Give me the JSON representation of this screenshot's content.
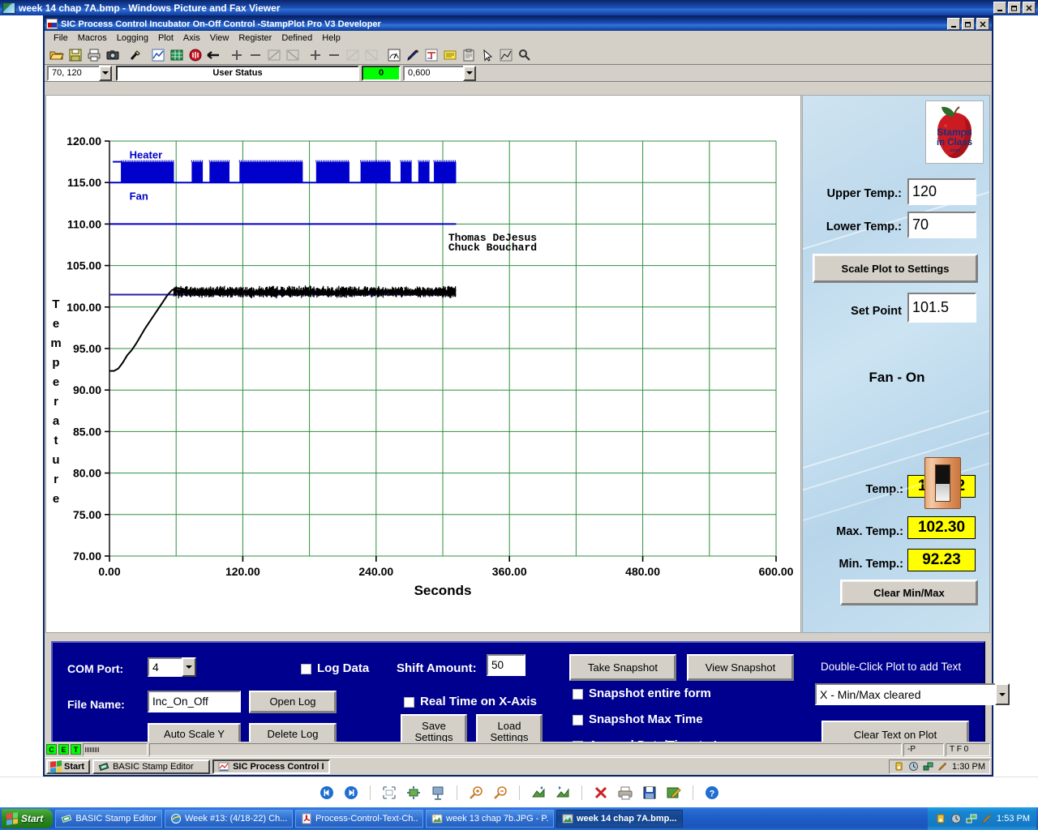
{
  "viewer": {
    "title": "week 14 chap 7A.bmp - Windows Picture and Fax Viewer",
    "icon": "image-file-icon",
    "controls": {
      "minimize": "minimize-icon",
      "restore": "restore-icon",
      "close": "close-icon"
    },
    "toolbar": [
      {
        "name": "previous-image-button",
        "glyph": "⏮"
      },
      {
        "name": "next-image-button",
        "glyph": "⏭"
      },
      {
        "name": "best-fit-button",
        "glyph": "⬚"
      },
      {
        "name": "actual-size-button",
        "glyph": "✥"
      },
      {
        "name": "start-slideshow-button",
        "glyph": "⏵"
      },
      {
        "name": "zoom-in-button",
        "glyph": "+"
      },
      {
        "name": "zoom-out-button",
        "glyph": "−"
      },
      {
        "name": "rotate-clockwise-button",
        "glyph": "↻"
      },
      {
        "name": "rotate-counterclockwise-button",
        "glyph": "↺"
      },
      {
        "name": "delete-button",
        "glyph": "✕"
      },
      {
        "name": "print-button",
        "glyph": "⎙"
      },
      {
        "name": "copy-to-button",
        "glyph": "💾"
      },
      {
        "name": "edit-image-button",
        "glyph": "✎"
      },
      {
        "name": "help-button",
        "glyph": "?"
      }
    ]
  },
  "app": {
    "title": "SIC Process Control Incubator On-Off Control -StampPlot Pro V3 Developer",
    "icon": "stampplot-icon",
    "menu": [
      "File",
      "Macros",
      "Logging",
      "Plot",
      "Axis",
      "View",
      "Register",
      "Defined",
      "Help"
    ],
    "toolbar_icons": [
      "open-file-icon",
      "save-file-icon",
      "print-icon",
      "camera-icon",
      "wand-icon",
      "plot-config-icon",
      "spreadsheet-icon",
      "stop-icon",
      "back-arrow-icon",
      "y-zoom-in-icon",
      "y-zoom-out-icon",
      "y-shift-up-icon",
      "y-shift-down-icon",
      "x-zoom-in-icon",
      "x-zoom-out-icon",
      "x-shift-left-icon",
      "x-shift-right-icon",
      "analog-meter-icon",
      "pen-icon",
      "text-icon",
      "notes-icon",
      "clipboard-icon",
      "pointer-icon",
      "trend-icon",
      "settings-icon"
    ],
    "range_combo": "70, 120",
    "user_status_label": "User Status",
    "counter_value": "0",
    "x_range_combo": "0,600"
  },
  "chart_data": {
    "type": "line",
    "title": "",
    "xlabel": "Seconds",
    "ylabel": "Temperature",
    "xlim": [
      0,
      600
    ],
    "ylim": [
      70,
      120
    ],
    "x_ticks": [
      "0.00",
      "120.00",
      "240.00",
      "360.00",
      "480.00",
      "600.00"
    ],
    "x_tick_values": [
      0,
      120,
      240,
      360,
      480,
      600
    ],
    "x_minor_step": 60,
    "y_ticks": [
      "120.00",
      "115.00",
      "110.00",
      "105.00",
      "100.00",
      "95.00",
      "90.00",
      "85.00",
      "80.00",
      "75.00",
      "70.00"
    ],
    "y_tick_values": [
      120,
      115,
      110,
      105,
      100,
      95,
      90,
      85,
      80,
      75,
      70
    ],
    "grid": true,
    "grid_color": "#2f8f3f",
    "trace_labels": [
      {
        "text": "Heater",
        "x": 18,
        "y": 117.9,
        "color": "#0000cc"
      },
      {
        "text": "Fan",
        "x": 18,
        "y": 112.9,
        "color": "#0000cc"
      }
    ],
    "annotations": [
      {
        "text": "Thomas  DeJesus",
        "x": 305,
        "y": 108.0
      },
      {
        "text": "Chuck  Bouchard",
        "x": 305,
        "y": 106.8
      }
    ],
    "series": [
      {
        "name": "Heater",
        "color": "#0000cc",
        "type": "digital",
        "low": 115.0,
        "high": 117.5,
        "note": "Digital on/off square wave, rapid toggling forms solid blue blocks",
        "on_segments": [
          [
            11,
            58
          ],
          [
            74,
            84
          ],
          [
            90,
            108
          ],
          [
            117,
            174
          ],
          [
            186,
            216
          ],
          [
            226,
            253
          ],
          [
            262,
            272
          ],
          [
            278,
            288
          ],
          [
            292,
            312
          ]
        ]
      },
      {
        "name": "Fan",
        "color": "#0000cc",
        "type": "digital",
        "low": 110.0,
        "high": 112.5,
        "note": "Fan line remains low (off state trace at 110) across logged period",
        "on_segments": []
      },
      {
        "name": "Set Point",
        "color": "#2222aa",
        "type": "reference",
        "value": 101.5,
        "x_start": 0,
        "x_end": 312
      },
      {
        "name": "Temperature",
        "color": "#000000",
        "type": "line",
        "x": [
          0,
          4,
          8,
          12,
          16,
          20,
          24,
          28,
          32,
          36,
          40,
          44,
          48,
          52,
          56,
          60,
          66,
          72,
          80,
          90,
          100,
          110,
          120,
          135,
          150,
          165,
          180,
          195,
          210,
          225,
          240,
          255,
          270,
          285,
          300,
          312
        ],
        "y": [
          92.3,
          92.3,
          92.6,
          93.3,
          94.2,
          94.8,
          95.6,
          96.5,
          97.4,
          98.2,
          99.0,
          99.8,
          100.6,
          101.4,
          102.0,
          102.3,
          102.2,
          101.9,
          101.6,
          101.8,
          101.5,
          101.7,
          101.9,
          101.6,
          101.8,
          102.0,
          101.7,
          101.5,
          101.9,
          101.6,
          101.8,
          102.0,
          101.7,
          101.9,
          101.8,
          102.0
        ],
        "note": "Noisy oscillation of +/- 0.5 deg about the set point after warm-up"
      }
    ]
  },
  "settings": {
    "upper_temp_label": "Upper Temp.:",
    "upper_temp_value": "120",
    "lower_temp_label": "Lower Temp.:",
    "lower_temp_value": "70",
    "scale_plot_button": "Scale Plot to Settings",
    "set_point_label": "Set Point",
    "set_point_value": "101.5",
    "fan_status": "Fan - On",
    "fan_switch_icon": "toggle-switch-icon",
    "temp_label": "Temp.:",
    "temp_value": "101.92",
    "max_temp_label": "Max. Temp.:",
    "max_temp_value": "102.30",
    "min_temp_label": "Min. Temp.:",
    "min_temp_value": "92.23",
    "clear_minmax_button": "Clear Min/Max",
    "logo_alt": "stamps-in-class-logo",
    "logo_line1": "Stamps",
    "logo_line2": "in Class",
    "logo_line3": ".com",
    "highlight_color": "#ffff00"
  },
  "controls": {
    "com_port_label": "COM Port:",
    "com_port_value": "4",
    "file_name_label": "File Name:",
    "file_name_value": "Inc_On_Off",
    "open_log_button": "Open Log",
    "delete_log_button": "Delete Log",
    "auto_scale_button": "Auto Scale Y",
    "log_data_label": "Log Data",
    "shift_amount_label": "Shift Amount:",
    "shift_amount_value": "50",
    "real_time_label": "Real Time on X-Axis",
    "save_settings_button": "Save\nSettings",
    "save_settings_l1": "Save",
    "save_settings_l2": "Settings",
    "load_settings_l1": "Load",
    "load_settings_l2": "Settings",
    "take_snapshot_button": "Take Snapshot",
    "view_snapshot_button": "View Snapshot",
    "snapshot_form_label": "Snapshot entire form",
    "snapshot_max_label": "Snapshot Max Time",
    "append_datetime_label": "Append Date/Time to Image",
    "double_click_hint": "Double-Click Plot to add Text",
    "text_combo_value": "X - Min/Max cleared",
    "clear_text_button": "Clear Text on Plot",
    "panel_color": "#00008e"
  },
  "status_bar": {
    "leds": [
      "C",
      "E",
      "T"
    ],
    "progress": "",
    "message": "",
    "field_p": "-P",
    "field_tf": "T F 0"
  },
  "inner_taskbar": {
    "start_label": "Start",
    "tasks": [
      {
        "label": "BASIC Stamp Editor",
        "icon": "basic-stamp-icon",
        "active": false
      },
      {
        "label": "SIC Process Control I...",
        "icon": "stampplot-icon",
        "active": true
      }
    ],
    "tray_icons": [
      "volume-icon",
      "clock-icon",
      "network-icon",
      "pencil-icon"
    ],
    "clock": "1:30 PM"
  },
  "desktop_taskbar": {
    "start_label": "Start",
    "tasks": [
      {
        "label": "BASIC Stamp Editor",
        "icon": "basic-stamp-icon",
        "active": false
      },
      {
        "label": "Week #13: (4/18-22) Ch...",
        "icon": "internet-explorer-icon",
        "active": false
      },
      {
        "label": "Process-Control-Text-Ch...",
        "icon": "acrobat-icon",
        "active": false
      },
      {
        "label": "week 13 chap 7b.JPG - P...",
        "icon": "image-viewer-icon",
        "active": false
      },
      {
        "label": "week 14 chap 7A.bmp...",
        "icon": "image-viewer-icon",
        "active": true
      }
    ],
    "tray_icons": [
      "volume-icon",
      "clock-icon",
      "network-icon",
      "pencil-icon"
    ],
    "clock": "1:53 PM"
  }
}
